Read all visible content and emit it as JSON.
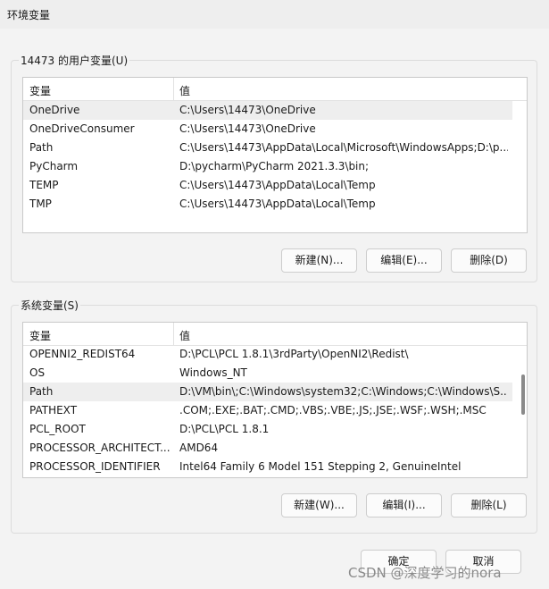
{
  "window": {
    "title": "环境变量"
  },
  "user_vars": {
    "label": "14473 的用户变量(U)",
    "columns": [
      "变量",
      "值"
    ],
    "rows": [
      {
        "name": "OneDrive",
        "value": "C:\\Users\\14473\\OneDrive"
      },
      {
        "name": "OneDriveConsumer",
        "value": "C:\\Users\\14473\\OneDrive"
      },
      {
        "name": "Path",
        "value": "C:\\Users\\14473\\AppData\\Local\\Microsoft\\WindowsApps;D:\\p..."
      },
      {
        "name": "PyCharm",
        "value": "D:\\pycharm\\PyCharm 2021.3.3\\bin;"
      },
      {
        "name": "TEMP",
        "value": "C:\\Users\\14473\\AppData\\Local\\Temp"
      },
      {
        "name": "TMP",
        "value": "C:\\Users\\14473\\AppData\\Local\\Temp"
      }
    ],
    "buttons": {
      "new": "新建(N)...",
      "edit": "编辑(E)...",
      "delete": "删除(D)"
    }
  },
  "system_vars": {
    "label": "系统变量(S)",
    "columns": [
      "变量",
      "值"
    ],
    "rows": [
      {
        "name": "OPENNI2_REDIST64",
        "value": "D:\\PCL\\PCL 1.8.1\\3rdParty\\OpenNI2\\Redist\\"
      },
      {
        "name": "OS",
        "value": "Windows_NT"
      },
      {
        "name": "Path",
        "value": "D:\\VM\\bin\\;C:\\Windows\\system32;C:\\Windows;C:\\Windows\\S..."
      },
      {
        "name": "PATHEXT",
        "value": ".COM;.EXE;.BAT;.CMD;.VBS;.VBE;.JS;.JSE;.WSF;.WSH;.MSC"
      },
      {
        "name": "PCL_ROOT",
        "value": "D:\\PCL\\PCL 1.8.1"
      },
      {
        "name": "PROCESSOR_ARCHITECT...",
        "value": "AMD64"
      },
      {
        "name": "PROCESSOR_IDENTIFIER",
        "value": "Intel64 Family 6 Model 151 Stepping 2, GenuineIntel"
      }
    ],
    "buttons": {
      "new": "新建(W)...",
      "edit": "编辑(I)...",
      "delete": "删除(L)"
    }
  },
  "dialog_buttons": {
    "ok": "确定",
    "cancel": "取消"
  },
  "watermark": "CSDN @深度学习的nora"
}
